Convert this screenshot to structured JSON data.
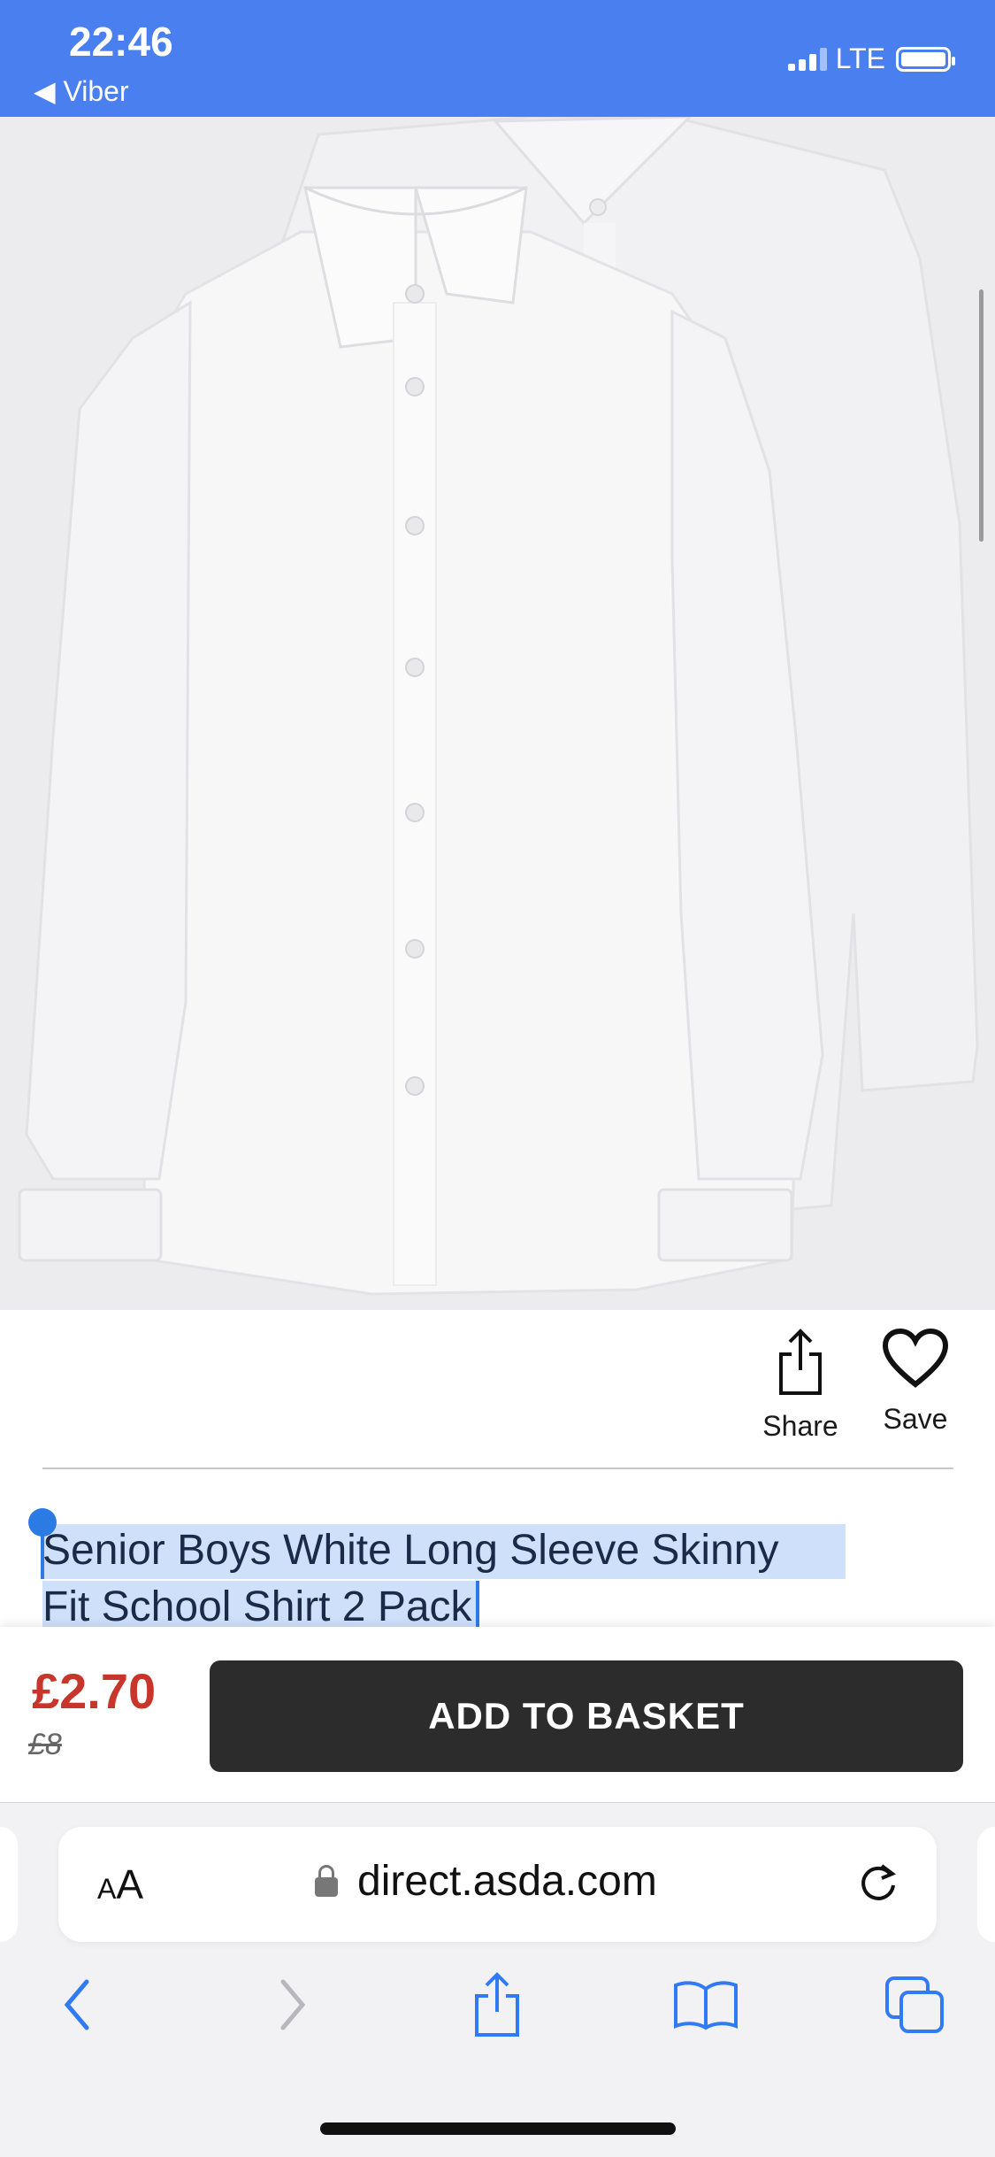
{
  "status_bar": {
    "time": "22:46",
    "back_label": "◀ Viber",
    "network": "LTE"
  },
  "product": {
    "image_alt": "two white long sleeve shirts",
    "title": "Senior Boys White Long Sleeve Skinny Fit School Shirt 2 Pack",
    "title_line1": "Senior Boys White Long Sleeve Skinny",
    "title_line2": "Fit School Shirt 2 Pack"
  },
  "actions": {
    "share_label": "Share",
    "save_label": "Save"
  },
  "buy_bar": {
    "price": "£2.70",
    "old_price": "£8",
    "add_to_basket_label": "ADD TO BASKET",
    "price_color": "#c8362b",
    "button_color": "#2c2c2c"
  },
  "browser": {
    "text_size_label_small": "A",
    "text_size_label_large": "A",
    "url": "direct.asda.com"
  },
  "colors": {
    "status_bar": "#4a7ff0",
    "selection": "#cfe0fa",
    "selection_handle": "#2c7be5",
    "ios_blue": "#2f7bf6"
  },
  "icons": {
    "share": "share-icon",
    "save": "heart-icon",
    "back": "chevron-left-icon",
    "forward": "chevron-right-icon",
    "browser_share": "share-icon",
    "bookmarks": "book-icon",
    "tabs": "tabs-icon",
    "reload": "reload-icon",
    "lock": "lock-icon"
  }
}
